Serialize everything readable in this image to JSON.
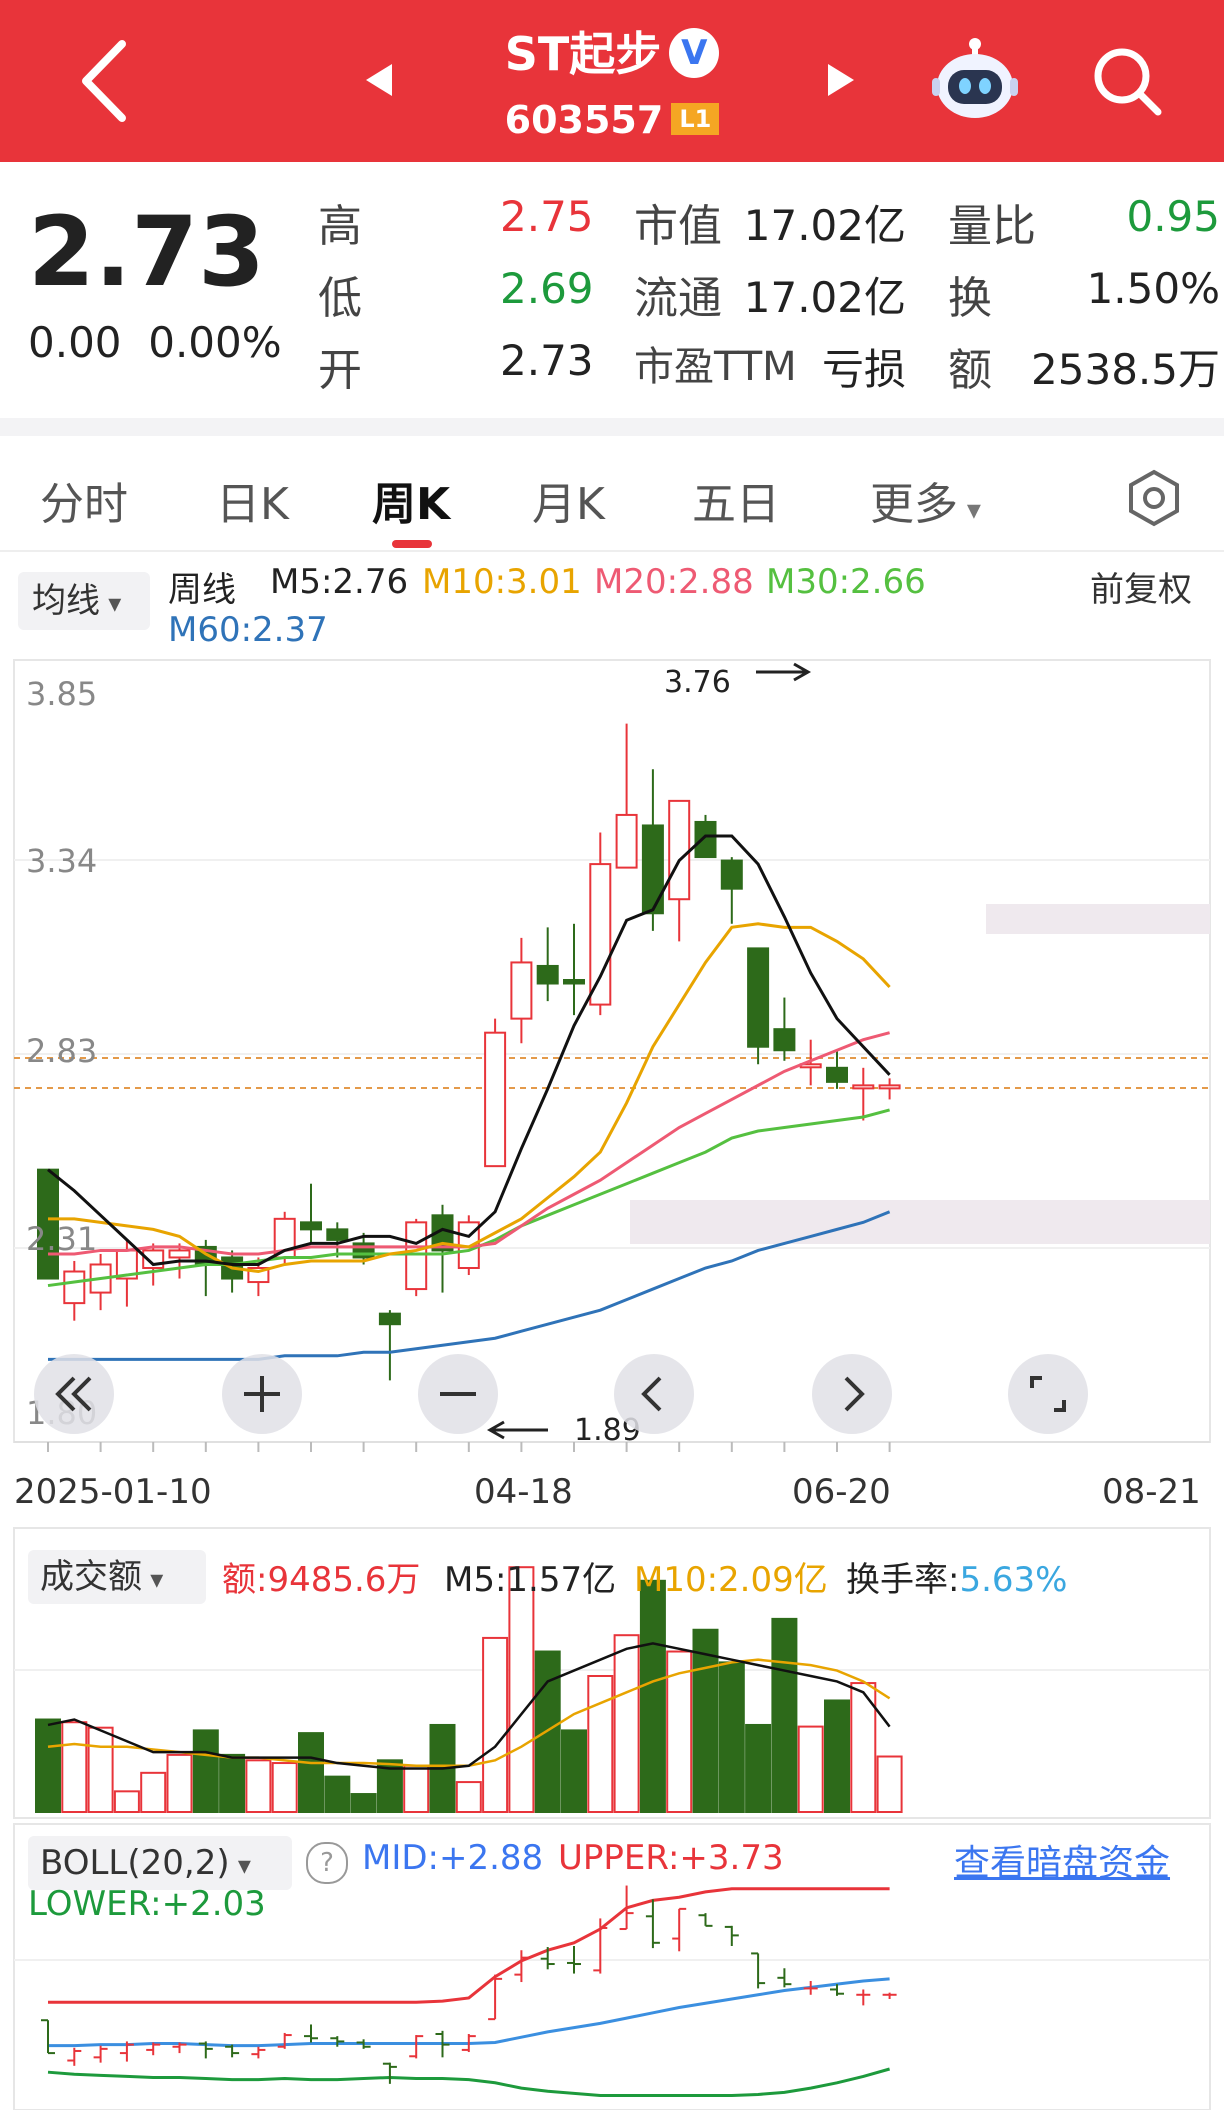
{
  "header": {
    "stock_name": "ST起步",
    "verified_mark": "V",
    "stock_code": "603557",
    "level_badge": "L1",
    "back_icon": "chevron-left-icon",
    "prev_icon": "triangle-left-icon",
    "next_icon": "triangle-right-icon",
    "assistant_icon": "robot-icon",
    "search_icon": "search-icon",
    "bg_color": "#e8343a"
  },
  "quote": {
    "price": "2.73",
    "change": "0.00",
    "change_pct": "0.00%",
    "high_label": "高",
    "high": "2.75",
    "low_label": "低",
    "low": "2.69",
    "open_label": "开",
    "open": "2.73",
    "mktcap_label": "市值",
    "mktcap": "17.02亿",
    "float_label": "流通",
    "float": "17.02亿",
    "pe_label": "市盈TTM",
    "pe": "亏损",
    "vol_ratio_label": "量比",
    "vol_ratio": "0.95",
    "turnover_label": "换",
    "turnover": "1.50%",
    "amount_label": "额",
    "amount": "2538.5万"
  },
  "tabs": [
    "分时",
    "日K",
    "周K",
    "月K",
    "五日",
    "更多"
  ],
  "active_tab": "周K",
  "ma_legend": {
    "selector": "均线",
    "period": "周线",
    "m5": "M5:2.76",
    "m10": "M10:3.01",
    "m20": "M20:2.88",
    "m30": "M30:2.66",
    "m60": "M60:2.37",
    "adjust": "前复权",
    "colors": {
      "m5": "#111111",
      "m10": "#e8a400",
      "m20": "#ee5a73",
      "m30": "#55c040",
      "m60": "#2f73b8"
    }
  },
  "kline": {
    "y_ticks": [
      "3.85",
      "3.34",
      "2.83",
      "2.31",
      "1.80"
    ],
    "max_label": "3.76",
    "min_label": "1.89",
    "dates": [
      "2025-01-10",
      "04-18",
      "06-20",
      "08-21"
    ],
    "up_color": "#e8343a",
    "down_color": "#2d6a1a"
  },
  "zoom_controls": [
    "double-left-icon",
    "zoom-in-icon",
    "zoom-out-icon",
    "left-icon",
    "right-icon",
    "fullscreen-icon"
  ],
  "volume": {
    "selector": "成交额",
    "amount": "额:9485.6万",
    "m5": "M5:1.57亿",
    "m10": "M10:2.09亿",
    "turnover_label": "换手率:",
    "turnover_value": "5.63%"
  },
  "boll": {
    "selector": "BOLL(20,2)",
    "help": "?",
    "mid": "MID:+2.88",
    "upper": "UPPER:+3.73",
    "lower": "LOWER:+2.03",
    "link": "查看暗盘资金"
  },
  "chart_data": {
    "type": "candlestick",
    "period": "weekly",
    "ylim": [
      1.8,
      3.85
    ],
    "candles": [
      {
        "o": 2.49,
        "c": 2.18,
        "h": 2.49,
        "l": 2.18
      },
      {
        "o": 2.11,
        "c": 2.2,
        "h": 2.23,
        "l": 2.06
      },
      {
        "o": 2.14,
        "c": 2.22,
        "h": 2.25,
        "l": 2.09
      },
      {
        "o": 2.18,
        "c": 2.26,
        "h": 2.29,
        "l": 2.1
      },
      {
        "o": 2.21,
        "c": 2.26,
        "h": 2.28,
        "l": 2.16
      },
      {
        "o": 2.24,
        "c": 2.26,
        "h": 2.28,
        "l": 2.18
      },
      {
        "o": 2.27,
        "c": 2.22,
        "h": 2.29,
        "l": 2.13
      },
      {
        "o": 2.24,
        "c": 2.18,
        "h": 2.26,
        "l": 2.14
      },
      {
        "o": 2.17,
        "c": 2.21,
        "h": 2.24,
        "l": 2.13
      },
      {
        "o": 2.24,
        "c": 2.35,
        "h": 2.37,
        "l": 2.22
      },
      {
        "o": 2.34,
        "c": 2.32,
        "h": 2.45,
        "l": 2.28
      },
      {
        "o": 2.32,
        "c": 2.29,
        "h": 2.34,
        "l": 2.24
      },
      {
        "o": 2.28,
        "c": 2.24,
        "h": 2.31,
        "l": 2.22
      },
      {
        "o": 2.08,
        "c": 2.05,
        "h": 2.09,
        "l": 1.89
      },
      {
        "o": 2.15,
        "c": 2.34,
        "h": 2.35,
        "l": 2.13
      },
      {
        "o": 2.36,
        "c": 2.26,
        "h": 2.39,
        "l": 2.14
      },
      {
        "o": 2.21,
        "c": 2.34,
        "h": 2.36,
        "l": 2.19
      },
      {
        "o": 2.5,
        "c": 2.88,
        "h": 2.92,
        "l": 2.5
      },
      {
        "o": 2.92,
        "c": 3.08,
        "h": 3.15,
        "l": 2.85
      },
      {
        "o": 3.07,
        "c": 3.02,
        "h": 3.18,
        "l": 2.97
      },
      {
        "o": 3.03,
        "c": 3.02,
        "h": 3.19,
        "l": 2.93
      },
      {
        "o": 2.96,
        "c": 3.36,
        "h": 3.45,
        "l": 2.93
      },
      {
        "o": 3.35,
        "c": 3.5,
        "h": 3.76,
        "l": 3.35
      },
      {
        "o": 3.47,
        "c": 3.22,
        "h": 3.63,
        "l": 3.17
      },
      {
        "o": 3.26,
        "c": 3.54,
        "h": 3.54,
        "l": 3.14
      },
      {
        "o": 3.48,
        "c": 3.38,
        "h": 3.5,
        "l": 3.38
      },
      {
        "o": 3.37,
        "c": 3.29,
        "h": 3.38,
        "l": 3.19
      },
      {
        "o": 3.12,
        "c": 2.84,
        "h": 3.12,
        "l": 2.79
      },
      {
        "o": 2.89,
        "c": 2.83,
        "h": 2.98,
        "l": 2.8
      },
      {
        "o": 2.79,
        "c": 2.79,
        "h": 2.86,
        "l": 2.73
      },
      {
        "o": 2.78,
        "c": 2.74,
        "h": 2.83,
        "l": 2.72
      },
      {
        "o": 2.73,
        "c": 2.73,
        "h": 2.78,
        "l": 2.63
      },
      {
        "o": 2.73,
        "c": 2.73,
        "h": 2.75,
        "l": 2.69
      }
    ],
    "ma5": [
      2.49,
      2.43,
      2.36,
      2.29,
      2.22,
      2.23,
      2.23,
      2.22,
      2.22,
      2.26,
      2.28,
      2.28,
      2.3,
      2.3,
      2.28,
      2.32,
      2.3,
      2.37,
      2.55,
      2.72,
      2.9,
      3.04,
      3.2,
      3.23,
      3.37,
      3.44,
      3.44,
      3.36,
      3.21,
      3.05,
      2.92,
      2.84,
      2.76
    ],
    "ma10": [
      2.35,
      2.35,
      2.34,
      2.33,
      2.32,
      2.3,
      2.25,
      2.21,
      2.2,
      2.22,
      2.23,
      2.23,
      2.23,
      2.25,
      2.26,
      2.28,
      2.27,
      2.31,
      2.35,
      2.41,
      2.47,
      2.54,
      2.68,
      2.84,
      2.96,
      3.08,
      3.18,
      3.19,
      3.18,
      3.18,
      3.14,
      3.09,
      3.01
    ],
    "ma20": [
      2.25,
      2.25,
      2.26,
      2.26,
      2.27,
      2.27,
      2.26,
      2.25,
      2.25,
      2.26,
      2.27,
      2.27,
      2.27,
      2.27,
      2.27,
      2.27,
      2.27,
      2.28,
      2.33,
      2.38,
      2.42,
      2.46,
      2.51,
      2.56,
      2.61,
      2.65,
      2.69,
      2.73,
      2.77,
      2.8,
      2.83,
      2.86,
      2.88
    ],
    "ma30": [
      2.16,
      2.17,
      2.18,
      2.19,
      2.2,
      2.21,
      2.22,
      2.22,
      2.23,
      2.24,
      2.24,
      2.25,
      2.25,
      2.25,
      2.25,
      2.25,
      2.26,
      2.29,
      2.33,
      2.36,
      2.39,
      2.42,
      2.45,
      2.48,
      2.51,
      2.54,
      2.58,
      2.6,
      2.61,
      2.62,
      2.63,
      2.64,
      2.66
    ],
    "ma60": [
      1.95,
      1.95,
      1.95,
      1.95,
      1.95,
      1.95,
      1.95,
      1.95,
      1.95,
      1.96,
      1.96,
      1.96,
      1.97,
      1.97,
      1.98,
      1.99,
      2.0,
      2.01,
      2.03,
      2.05,
      2.07,
      2.09,
      2.12,
      2.15,
      2.18,
      2.21,
      2.23,
      2.26,
      2.28,
      2.3,
      2.32,
      2.34,
      2.37
    ],
    "volume_amount_yi": [
      1.7,
      1.65,
      1.55,
      0.38,
      0.72,
      1.05,
      1.5,
      1.05,
      0.95,
      0.9,
      1.45,
      0.65,
      0.33,
      0.95,
      0.85,
      1.6,
      0.55,
      3.2,
      4.5,
      2.95,
      1.5,
      2.5,
      3.25,
      4.25,
      2.95,
      3.35,
      2.75,
      1.6,
      3.55,
      1.57,
      2.05,
      2.37,
      1.02
    ],
    "volume_ma5": [
      1.6,
      1.7,
      1.5,
      1.3,
      1.1,
      1.1,
      1.1,
      1.0,
      1.0,
      1.0,
      1.0,
      0.9,
      0.85,
      0.8,
      0.8,
      0.8,
      0.85,
      1.2,
      1.8,
      2.4,
      2.6,
      2.8,
      3.0,
      3.1,
      3.0,
      2.9,
      2.8,
      2.7,
      2.6,
      2.5,
      2.4,
      2.2,
      1.57
    ],
    "volume_ma10": [
      1.2,
      1.25,
      1.2,
      1.2,
      1.15,
      1.1,
      1.05,
      1.0,
      1.0,
      0.95,
      0.9,
      0.9,
      0.9,
      0.88,
      0.85,
      0.85,
      0.85,
      0.95,
      1.2,
      1.5,
      1.8,
      2.0,
      2.2,
      2.4,
      2.55,
      2.65,
      2.75,
      2.8,
      2.75,
      2.7,
      2.6,
      2.4,
      2.09
    ],
    "boll_mid": [
      2.25,
      2.25,
      2.26,
      2.26,
      2.27,
      2.27,
      2.26,
      2.25,
      2.25,
      2.26,
      2.27,
      2.27,
      2.27,
      2.27,
      2.27,
      2.27,
      2.27,
      2.28,
      2.33,
      2.38,
      2.42,
      2.46,
      2.51,
      2.56,
      2.61,
      2.65,
      2.69,
      2.73,
      2.77,
      2.8,
      2.83,
      2.86,
      2.88
    ],
    "boll_upper": [
      2.66,
      2.66,
      2.66,
      2.66,
      2.66,
      2.66,
      2.66,
      2.66,
      2.66,
      2.66,
      2.66,
      2.66,
      2.66,
      2.66,
      2.66,
      2.67,
      2.7,
      2.9,
      3.05,
      3.15,
      3.22,
      3.35,
      3.55,
      3.62,
      3.65,
      3.7,
      3.73,
      3.73,
      3.73,
      3.73,
      3.73,
      3.73,
      3.73
    ],
    "boll_lower": [
      2.0,
      1.98,
      1.97,
      1.96,
      1.95,
      1.95,
      1.94,
      1.93,
      1.93,
      1.94,
      1.93,
      1.93,
      1.94,
      1.95,
      1.94,
      1.94,
      1.93,
      1.9,
      1.85,
      1.82,
      1.8,
      1.78,
      1.78,
      1.78,
      1.78,
      1.78,
      1.78,
      1.79,
      1.81,
      1.85,
      1.9,
      1.96,
      2.03
    ]
  }
}
